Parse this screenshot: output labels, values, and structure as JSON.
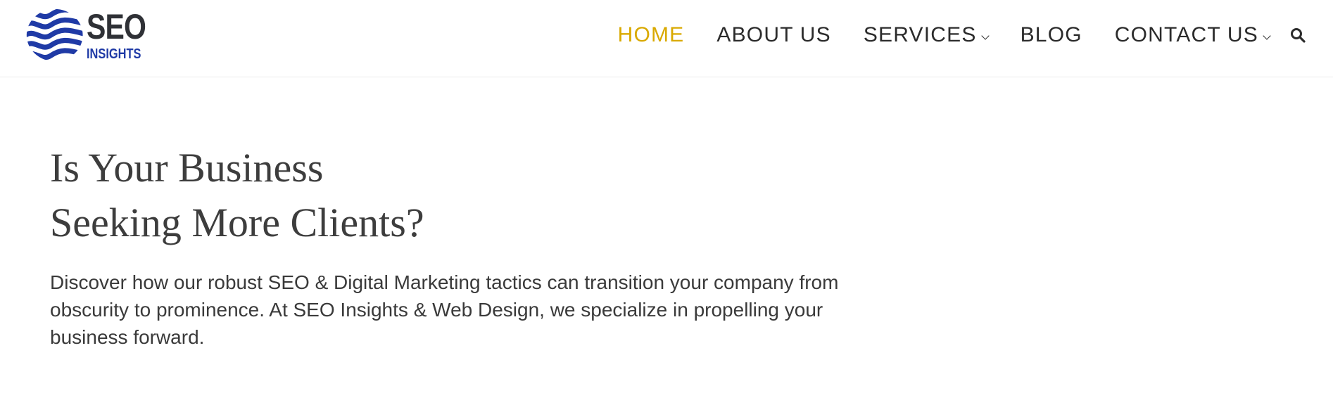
{
  "brand": {
    "name_main": "SEO",
    "name_sub": "INSIGHTS",
    "colors": {
      "dark": "#2f3136",
      "blue": "#1f3aa6",
      "accent": "#d9a900"
    }
  },
  "nav": {
    "items": [
      {
        "label": "HOME",
        "active": true,
        "has_dropdown": false
      },
      {
        "label": "ABOUT US",
        "active": false,
        "has_dropdown": false
      },
      {
        "label": "SERVICES",
        "active": false,
        "has_dropdown": true
      },
      {
        "label": "BLOG",
        "active": false,
        "has_dropdown": false
      },
      {
        "label": "CONTACT US",
        "active": false,
        "has_dropdown": true
      }
    ],
    "search_icon": "search-icon"
  },
  "hero": {
    "title_line1": "Is Your Business",
    "title_line2": "Seeking More Clients?",
    "description": "Discover how our robust SEO & Digital Marketing tactics can transition your company from obscurity to prominence. At SEO Insights & Web Design, we specialize in propelling your business forward."
  }
}
